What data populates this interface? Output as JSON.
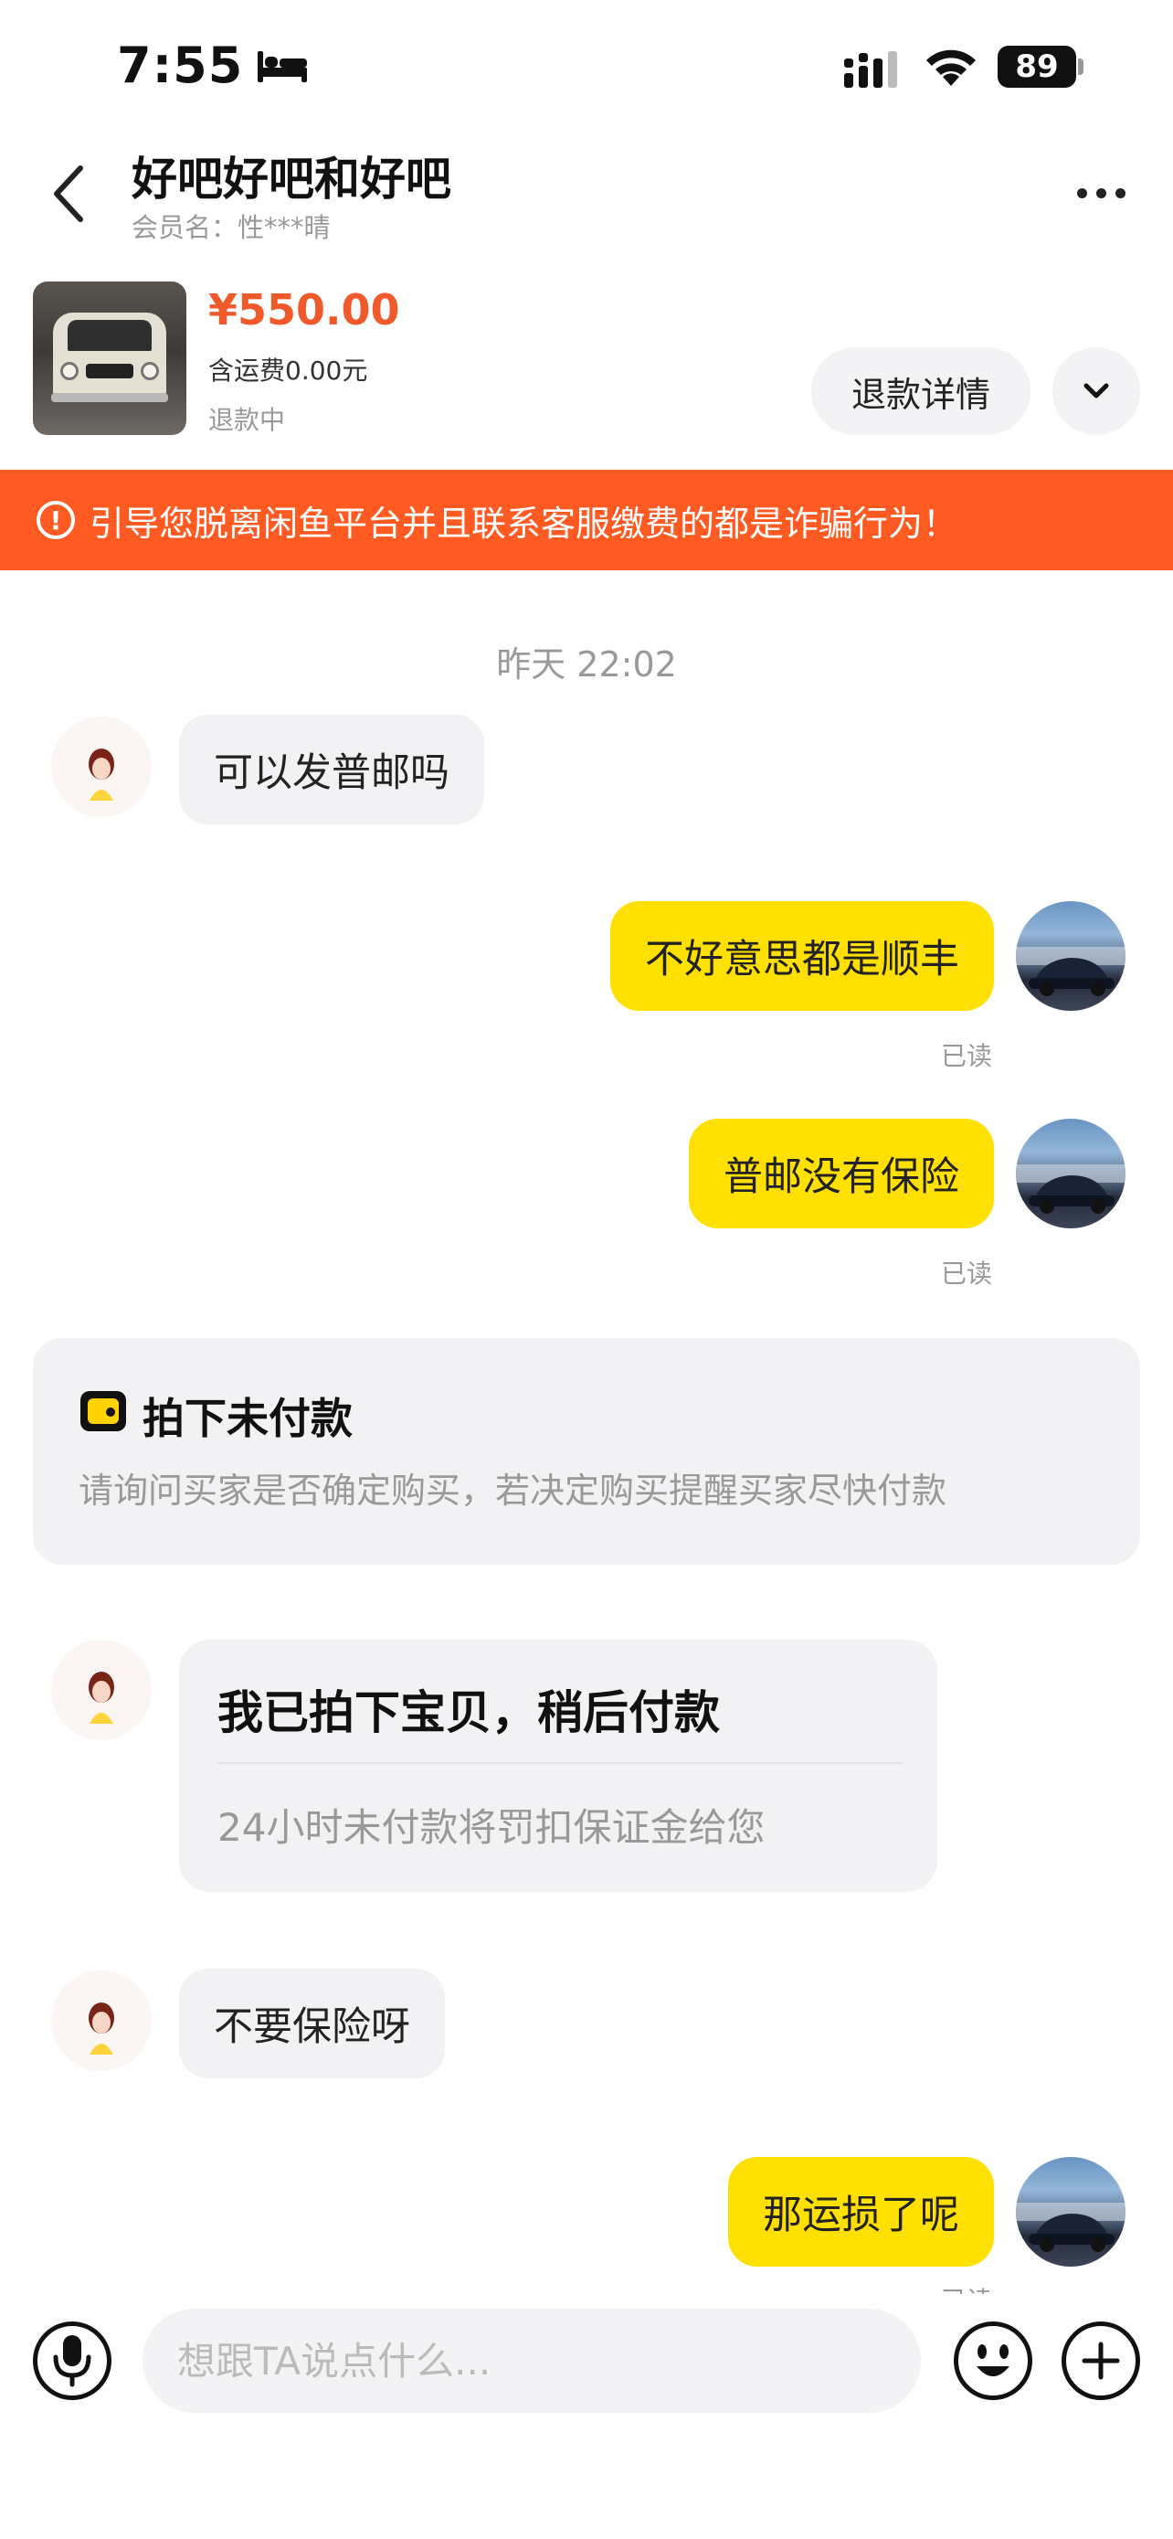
{
  "status_bar": {
    "time": "7:55",
    "battery": "89"
  },
  "header": {
    "title": "好吧好吧和好吧",
    "subtitle": "会员名：性***晴"
  },
  "product": {
    "price": "¥550.00",
    "shipping": "含运费0.00元",
    "status": "退款中",
    "refund_button": "退款详情"
  },
  "warning": {
    "icon_text": "!",
    "text": "引导您脱离闲鱼平台并且联系客服缴费的都是诈骗行为！"
  },
  "chat": {
    "timestamp": "昨天 22:02",
    "messages": [
      {
        "side": "in",
        "text": "可以发普邮吗"
      },
      {
        "side": "out",
        "text": "不好意思都是顺丰",
        "status": "已读"
      },
      {
        "side": "out",
        "text": "普邮没有保险",
        "status": "已读"
      },
      {
        "side": "in",
        "text": "不要保险呀"
      },
      {
        "side": "out",
        "text": "那运损了呢",
        "status": "已读"
      }
    ],
    "system_card": {
      "title": "拍下未付款",
      "desc": "请询问买家是否确定购买，若决定购买提醒买家尽快付款"
    },
    "order_card": {
      "title": "我已拍下宝贝，稍后付款",
      "desc": "24小时未付款将罚扣保证金给您"
    }
  },
  "input_bar": {
    "placeholder": "想跟TA说点什么..."
  },
  "colors": {
    "accent_yellow": "#ffe000",
    "warning_orange": "#ff5a22",
    "price_orange": "#f05a2a"
  }
}
